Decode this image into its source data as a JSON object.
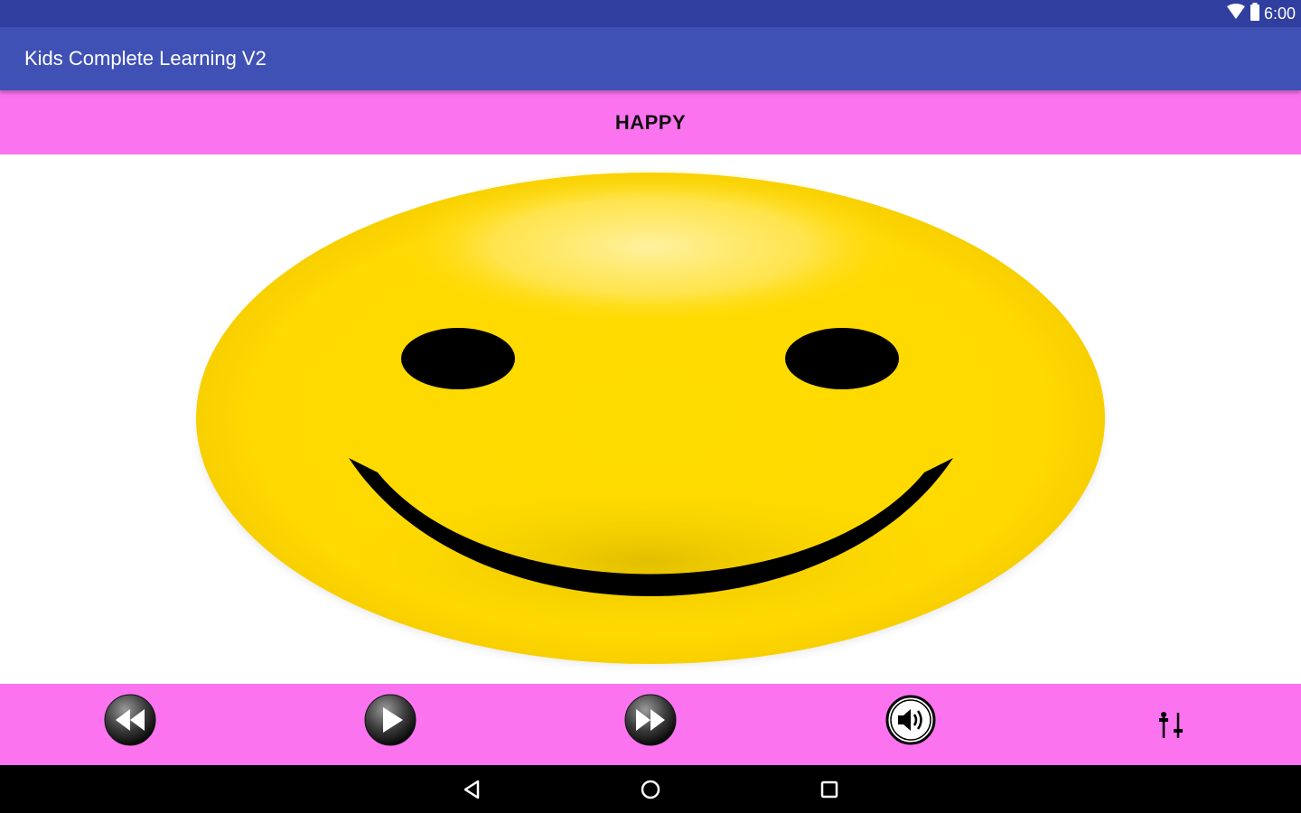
{
  "status_bar": {
    "time": "6:00",
    "icons": [
      "wifi-icon",
      "battery-icon"
    ]
  },
  "app_bar": {
    "title": "Kids Complete Learning V2",
    "color": "#3f51b5"
  },
  "word": {
    "label": "HAPPY"
  },
  "image": {
    "subject": "smiley-face-icon",
    "face_color": "#ffd900"
  },
  "controls": {
    "background": "#fb73ef",
    "buttons": [
      "rewind-icon",
      "play-icon",
      "fast-forward-icon",
      "volume-icon",
      "settings-sliders-icon"
    ]
  },
  "navigation": {
    "buttons": [
      "back-icon",
      "home-icon",
      "recents-icon"
    ]
  }
}
